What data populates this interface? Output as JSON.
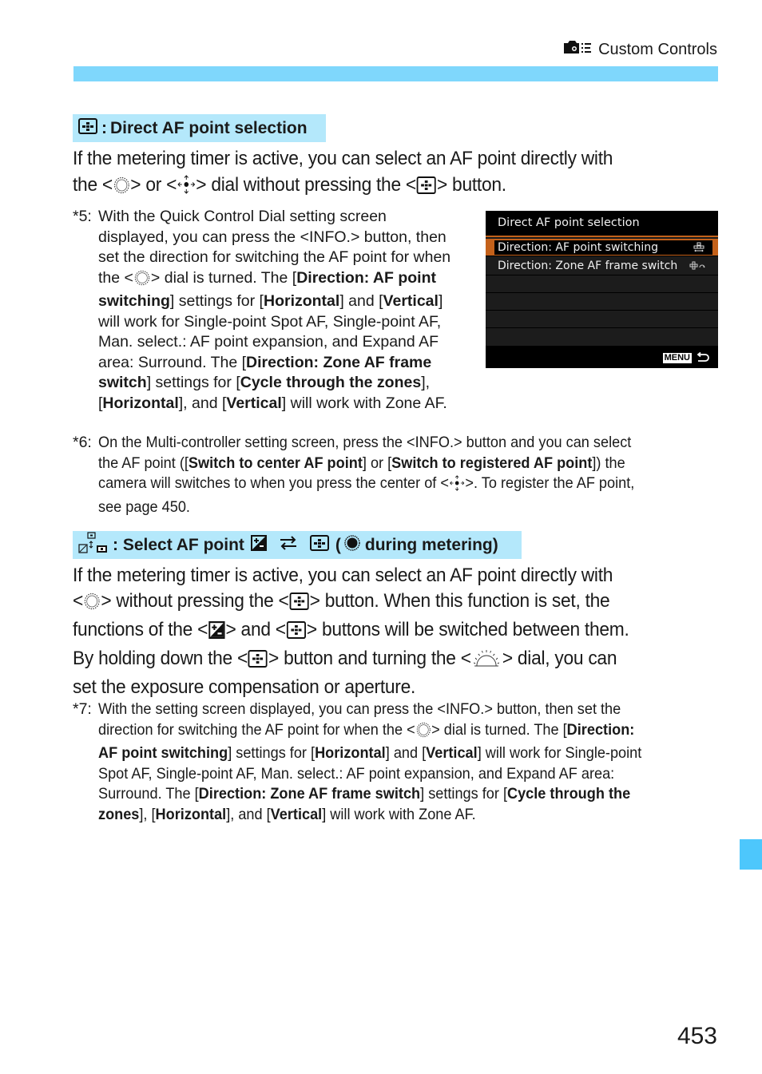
{
  "header": {
    "section_icon": "camera-custom-controls-icon",
    "title": "Custom Controls",
    "accent_color": "#7fd7fc"
  },
  "section1": {
    "icon": "af-point-selection-button-icon",
    "title": "Direct AF point selection",
    "body": {
      "line1": "If the metering timer is active, you can select an AF point directly with",
      "l2_a": "the <",
      "l2_b": "> or <",
      "l2_c": "> dial without pressing the <",
      "l2_d": "> button."
    },
    "note5": {
      "num": "*5:",
      "lines": [
        "With the Quick Control Dial setting screen",
        "displayed, you can press the <INFO.> button, then",
        "set the direction for switching the AF point for when"
      ],
      "l4_a": "the <",
      "l4_b": "> dial is turned. The [",
      "l4_bold": "Direction: AF point",
      "l5_bold1": "switching",
      "l5_a": "] settings for [",
      "l5_bold2": "Horizontal",
      "l5_b": "] and [",
      "l5_bold3": "Vertical",
      "l5_c": "]",
      "l6": "will work for Single-point Spot AF, Single-point AF,",
      "l7": "Man. select.: AF point expansion, and Expand AF",
      "l8_a": "area: Surround. The [",
      "l8_bold": "Direction: Zone AF frame",
      "l9_bold1": "switch",
      "l9_a": "] settings for [",
      "l9_bold2": "Cycle through the zones",
      "l9_b": "],",
      "l10_a": "[",
      "l10_bold1": "Horizontal",
      "l10_b": "], and [",
      "l10_bold2": "Vertical",
      "l10_c": "] will work with Zone AF."
    },
    "camera_screen": {
      "title": "Direct AF point selection",
      "items": [
        {
          "label": "Direction: AF point switching",
          "icon": "af-point-switching-icon",
          "selected": true
        },
        {
          "label": "Direction: Zone AF frame switch",
          "icon": "zone-af-frame-switch-icon",
          "selected": false
        }
      ],
      "footer_menu": "MENU",
      "footer_icon": "back-arrow-icon",
      "highlight_color": "#c4611a"
    },
    "note6": {
      "num": "*6:",
      "l1": "On the Multi-controller setting screen, press the <INFO.> button and you can select",
      "l2_a": "the AF point ([",
      "l2_bold1": "Switch to center AF point",
      "l2_b": "] or [",
      "l2_bold2": "Switch to registered AF point",
      "l2_c": "]) the",
      "l3_a": "camera will switches to when you press the center of <",
      "l3_b": ">. To register the AF point,",
      "l4": "see page 450."
    }
  },
  "section2": {
    "icon": "af-exposure-swap-icon",
    "title_a": ": Select AF point",
    "title_b": "(",
    "title_c": "during metering)",
    "body": {
      "line1": "If the metering timer is active, you can select an AF point directly with",
      "l2_a": "<",
      "l2_b": "> without pressing the <",
      "l2_c": "> button. When this function is set, the",
      "l3_a": "functions of the <",
      "l3_b": "> and <",
      "l3_c": "> buttons will be switched between them.",
      "l4_a": "By holding down the <",
      "l4_b": "> button and turning the <",
      "l4_c": "> dial, you can",
      "l5": "set the exposure compensation or aperture."
    },
    "note7": {
      "num": "*7:",
      "l1": "With the setting screen displayed, you can press the <INFO.> button, then set the",
      "l2_a": "direction for switching the AF point for when the <",
      "l2_b": "> dial is turned. The [",
      "l2_bold": "Direction:",
      "l3_bold1": "AF point switching",
      "l3_a": "] settings for [",
      "l3_bold2": "Horizontal",
      "l3_b": "] and [",
      "l3_bold3": "Vertical",
      "l3_c": "] will work for Single-point",
      "l4": "Spot AF, Single-point AF, Man. select.: AF point expansion, and Expand AF area:",
      "l5_a": "Surround. The [",
      "l5_bold1": "Direction: Zone AF frame switch",
      "l5_b": "] settings for [",
      "l5_bold2": "Cycle through the",
      "l6_bold1": "zones",
      "l6_a": "], [",
      "l6_bold2": "Horizontal",
      "l6_b": "], and [",
      "l6_bold3": "Vertical",
      "l6_c": "] will work with Zone AF."
    }
  },
  "side_tab_color": "#4dc7fc",
  "page_number": "453"
}
